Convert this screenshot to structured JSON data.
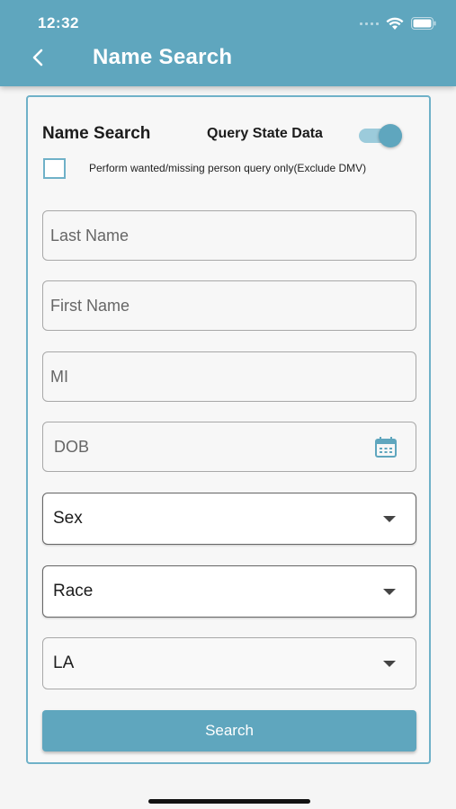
{
  "status_bar": {
    "time": "12:32"
  },
  "nav": {
    "title": "Name Search",
    "back_icon": "chevron-left-icon"
  },
  "form": {
    "title": "Name Search",
    "toggle_label": "Query State Data",
    "toggle_on": true,
    "checkbox_label": "Perform wanted/missing person query only(Exclude DMV)",
    "checkbox_checked": false,
    "fields": {
      "last_name_placeholder": "Last Name",
      "first_name_placeholder": "First Name",
      "mi_placeholder": "MI",
      "dob_placeholder": "DOB"
    },
    "selects": {
      "sex": "Sex",
      "race": "Race",
      "state": "LA"
    },
    "search_label": "Search"
  },
  "colors": {
    "accent": "#5fa6be",
    "toggle_track": "#9ccbdb"
  }
}
